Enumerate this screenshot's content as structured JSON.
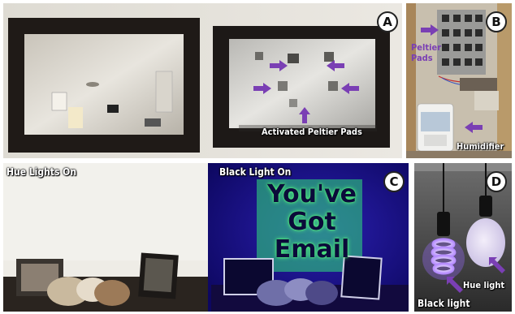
{
  "panels": {
    "a": {
      "badge": "A",
      "caption": "Activated Peltier Pads"
    },
    "b": {
      "badge": "B",
      "peltier_label_line1": "Peltier",
      "peltier_label_line2": "Pads",
      "humidifier_label": "Humidifier"
    },
    "c": {
      "badge": "C",
      "left_label": "Hue Lights On",
      "right_label": "Black Light On",
      "screen_line1": "You've",
      "screen_line2": "Got",
      "screen_line3": "Email"
    },
    "d": {
      "badge": "D",
      "hue_label": "Hue light",
      "black_label": "Black light"
    }
  },
  "colors": {
    "arrow": "#7a3fb4",
    "glow": "#57ff7a"
  }
}
